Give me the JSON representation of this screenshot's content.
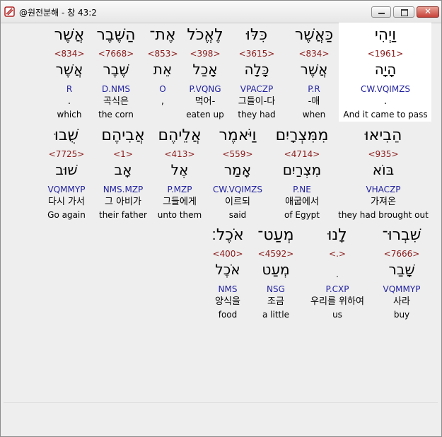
{
  "window": {
    "title": "@원전분해 - 창 43:2",
    "close_glyph": "✕"
  },
  "rows": [
    {
      "words": [
        {
          "heb": "וַיְהִי",
          "strong": "<1961>",
          "lemma": "הָיָה",
          "parse": "CW.VQIMZS",
          "korean": ".",
          "english": "And it came to pass"
        },
        {
          "heb": "כַּאֲשֶׁר",
          "strong": "<834>",
          "lemma": "אֲשֶׁר",
          "parse": "P.R",
          "korean": "-매",
          "english": "when"
        },
        {
          "heb": "כִּלּוּ",
          "strong": "<3615>",
          "lemma": "כָּלָה",
          "parse": "VPACZP",
          "korean": "그들이-다",
          "english": "they had"
        },
        {
          "heb": "לֶאֱכֹל",
          "strong": "<398>",
          "lemma": "אָכַל",
          "parse": "P.VQNG",
          "korean": "먹어-",
          "english": "eaten up"
        },
        {
          "heb": "אֶת־",
          "strong": "<853>",
          "lemma": "אֵת",
          "parse": "O",
          "korean": ",",
          "english": ""
        },
        {
          "heb": "הַשֶּׁבֶר",
          "strong": "<7668>",
          "lemma": "שֶׁבֶר",
          "parse": "D.NMS",
          "korean": "곡식은",
          "english": "the corn"
        },
        {
          "heb": "אֲשֶׁר",
          "strong": "<834>",
          "lemma": "אֲשֶׁר",
          "parse": "R",
          "korean": ".",
          "english": "which"
        }
      ]
    },
    {
      "words": [
        {
          "heb": "הֵבִיאוּ",
          "strong": "<935>",
          "lemma": "בּוֹא",
          "parse": "VHACZP",
          "korean": "가져온",
          "english": "they had brought out"
        },
        {
          "heb": "מִמִּצְרָיִם",
          "strong": "<4714>",
          "lemma": "מִצְרַיִם",
          "parse": "P.NE",
          "korean": "애굽에서",
          "english": "of Egypt"
        },
        {
          "heb": "וַיֹּאמֶר",
          "strong": "<559>",
          "lemma": "אָמַר",
          "parse": "CW.VQIMZS",
          "korean": "이르되",
          "english": "said"
        },
        {
          "heb": "אֲלֵיהֶם",
          "strong": "<413>",
          "lemma": "אֶל",
          "parse": "P.MZP",
          "korean": "그들에게",
          "english": "unto them"
        },
        {
          "heb": "אֲבִיהֶם",
          "strong": "<1>",
          "lemma": "אָב",
          "parse": "NMS.MZP",
          "korean": "그 아비가",
          "english": "their father"
        },
        {
          "heb": "שֻׁבוּ",
          "strong": "<7725>",
          "lemma": "שׁוּב",
          "parse": "VQMMYP",
          "korean": "다시 가서",
          "english": "Go again"
        }
      ]
    },
    {
      "words": [
        {
          "heb": "שִׁבְרוּ־",
          "strong": "<7666>",
          "lemma": "שָׁבַר",
          "parse": "VQMMYP",
          "korean": "사라",
          "english": "buy"
        },
        {
          "heb": "לָנוּ",
          "strong": "<.>",
          "lemma": "ׅ",
          "parse": "P.CXP",
          "korean": "우리를 위하여",
          "english": "us"
        },
        {
          "heb": "מְעַט־",
          "strong": "<4592>",
          "lemma": "מְעַט",
          "parse": "NSG",
          "korean": "조금",
          "english": "a little"
        },
        {
          "heb": "אֹכֶל׃",
          "strong": "<400>",
          "lemma": "אֹכֶל",
          "parse": "NMS",
          "korean": "양식을",
          "english": "food"
        }
      ]
    }
  ]
}
